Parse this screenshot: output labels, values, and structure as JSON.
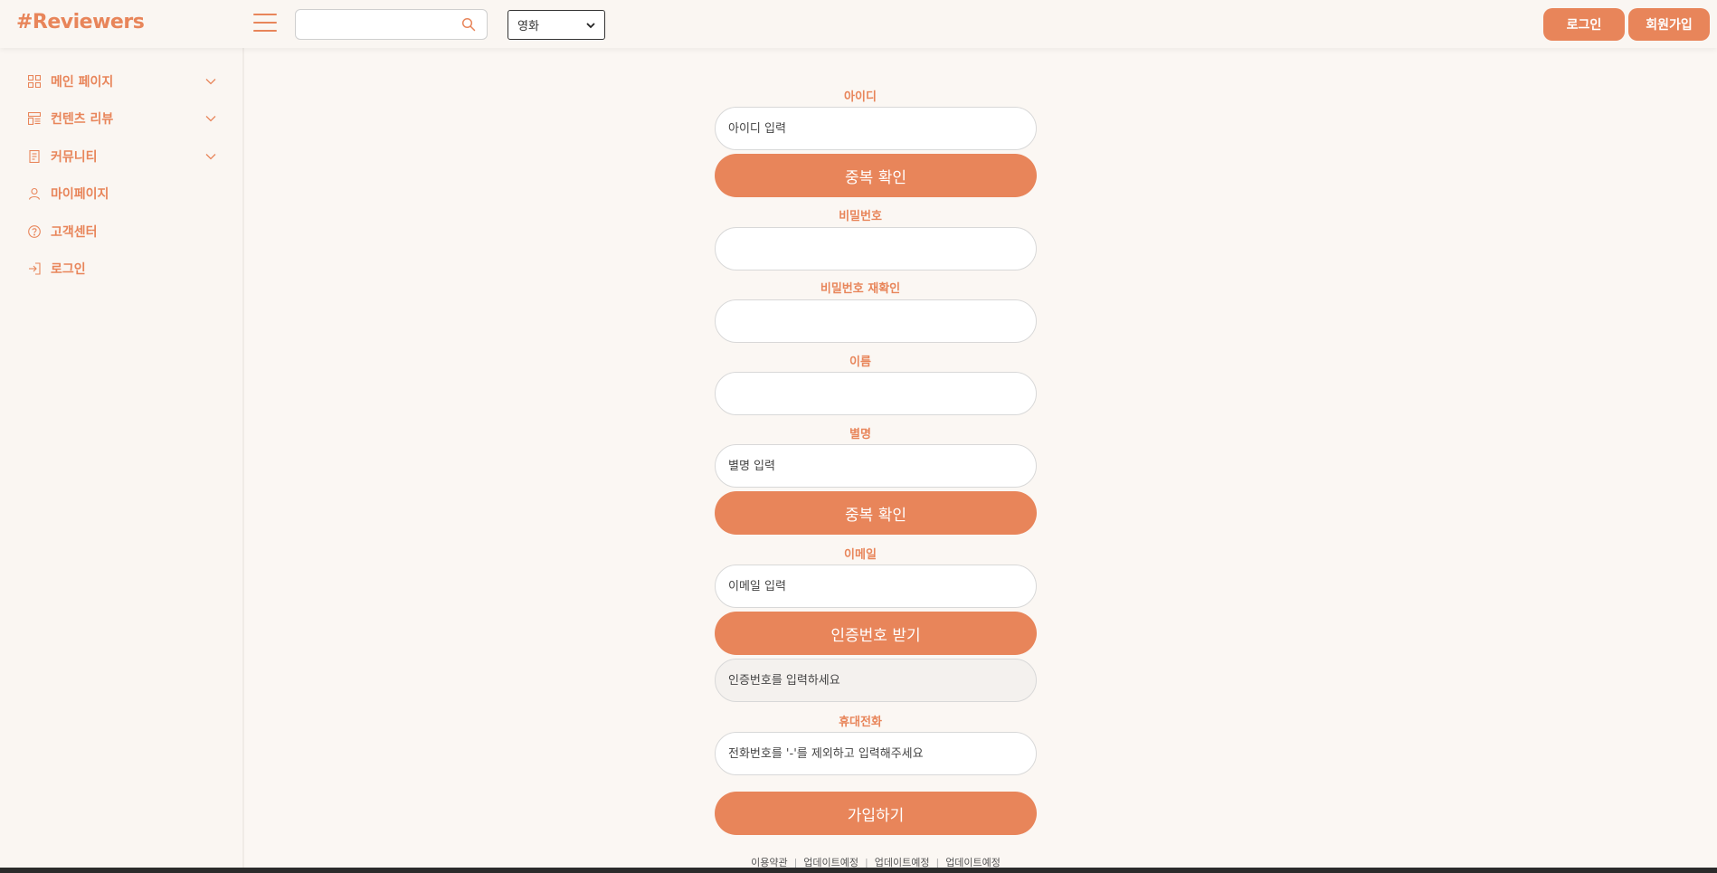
{
  "header": {
    "logo": "#Reviewers",
    "search_placeholder": "",
    "category_selected": "영화",
    "login_label": "로그인",
    "signup_label": "회원가입"
  },
  "sidebar": {
    "items": [
      {
        "label": "메인 페이지",
        "icon": "grid-icon",
        "has_chevron": true
      },
      {
        "label": "컨텐츠 리뷰",
        "icon": "content-list-icon",
        "has_chevron": true
      },
      {
        "label": "커뮤니티",
        "icon": "document-icon",
        "has_chevron": true
      },
      {
        "label": "마이페이지",
        "icon": "user-icon",
        "has_chevron": false
      },
      {
        "label": "고객센터",
        "icon": "help-circle-icon",
        "has_chevron": false
      },
      {
        "label": "로그인",
        "icon": "login-icon",
        "has_chevron": false
      }
    ]
  },
  "form": {
    "id_label": "아이디",
    "id_placeholder": "아이디 입력",
    "id_check_button": "중복 확인",
    "password_label": "비밀번호",
    "password_confirm_label": "비밀번호 재확인",
    "name_label": "이름",
    "nickname_label": "별명",
    "nickname_placeholder": "별명 입력",
    "nickname_check_button": "중복 확인",
    "email_label": "이메일",
    "email_placeholder": "이메일 입력",
    "email_verify_button": "인증번호 받기",
    "verify_code_placeholder": "인증번호를 입력하세요",
    "phone_label": "휴대전화",
    "phone_placeholder": "전화번호를 '-'를 제외하고 입력해주세요",
    "submit_button": "가입하기"
  },
  "footer": {
    "links": [
      "이용약관",
      "업데이트예정",
      "업데이트예정",
      "업데이트예정"
    ]
  },
  "colors": {
    "accent": "#e8855a",
    "background": "#fbf7f3"
  }
}
